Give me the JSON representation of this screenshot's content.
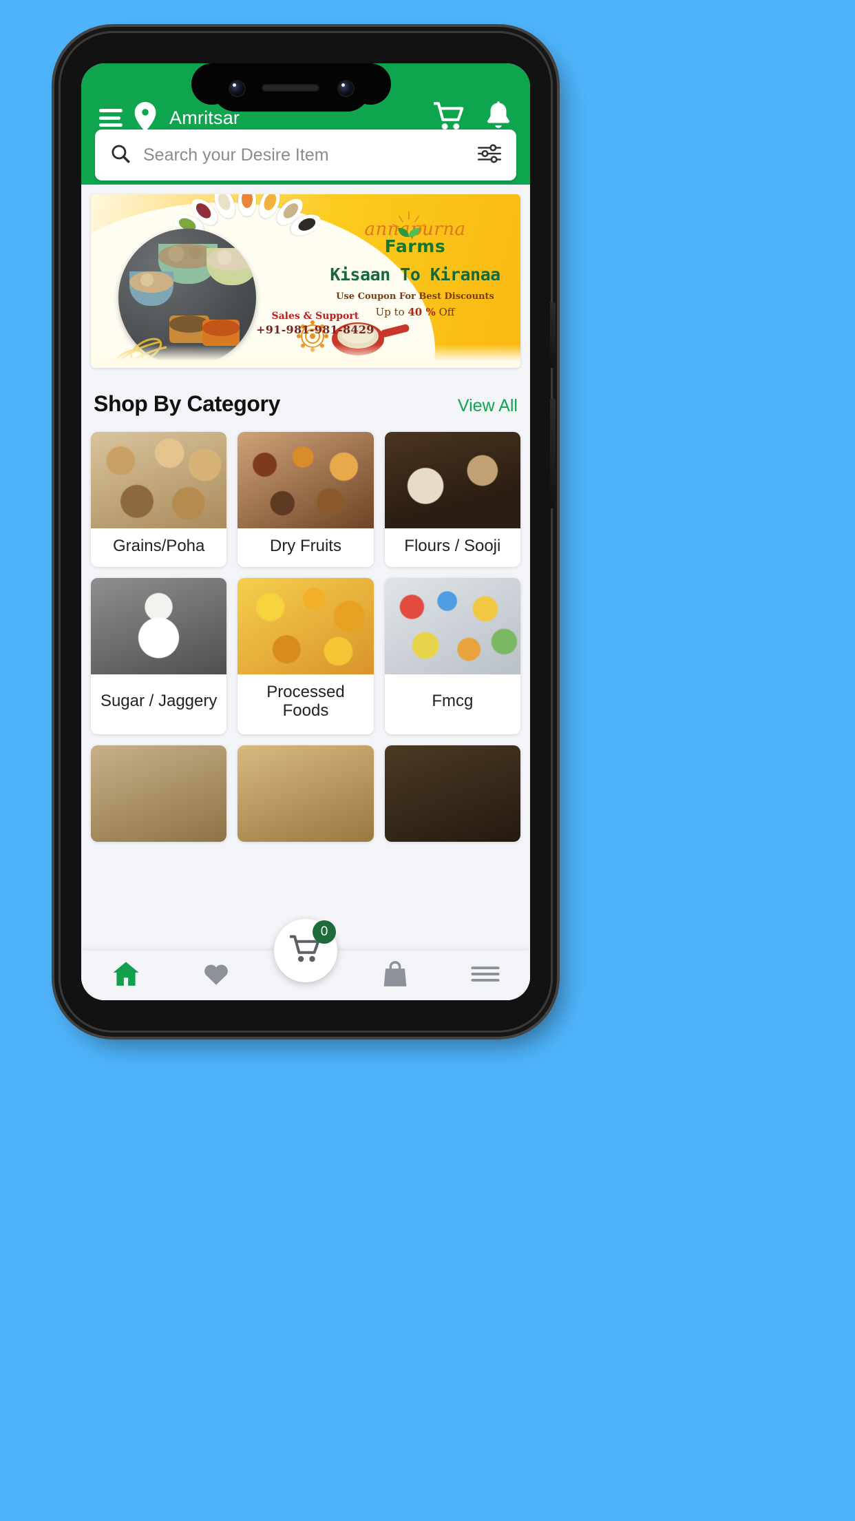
{
  "app": {
    "brand_green": "#0FA54F",
    "page_background": "#4FB4FB"
  },
  "appbar": {
    "menu_icon": "hamburger-menu-icon",
    "location_icon": "location-pin-icon",
    "location": "Amritsar",
    "cart_icon": "shopping-cart-icon",
    "notification_icon": "bell-icon"
  },
  "search": {
    "icon": "search-icon",
    "placeholder": "Search your Desire Item",
    "value": "",
    "filter_icon": "filter-sliders-icon"
  },
  "banner": {
    "logo_script": "annapurna",
    "logo_name": "Farms",
    "tagline": "Kisaan To Kiranaa",
    "coupon_line": "Use Coupon For Best Discounts",
    "offer_prefix": "Up to ",
    "offer_amount": "40 %",
    "offer_suffix": " Off",
    "support_title": "Sales & Support",
    "support_phone": "+91-981-981-8429"
  },
  "categories_section": {
    "title": "Shop By Category",
    "view_all": "View All",
    "items": [
      {
        "label": "Grains/Poha",
        "img": "img-grains"
      },
      {
        "label": "Dry Fruits",
        "img": "img-dryfruits"
      },
      {
        "label": "Flours / Sooji",
        "img": "img-flours"
      },
      {
        "label": "Sugar / Jaggery",
        "img": "img-sugar"
      },
      {
        "label": "Processed Foods",
        "img": "img-processed"
      },
      {
        "label": "Fmcg",
        "img": "img-fmcg"
      }
    ]
  },
  "bottom_nav": {
    "items": [
      {
        "name": "home",
        "icon": "home-icon",
        "active": true
      },
      {
        "name": "wishlist",
        "icon": "heart-icon",
        "active": false
      },
      {
        "name": "orders",
        "icon": "bag-icon",
        "active": false
      },
      {
        "name": "more",
        "icon": "menu-lines-icon",
        "active": false
      }
    ],
    "cart_fab_icon": "shopping-cart-icon",
    "cart_count": "0"
  }
}
